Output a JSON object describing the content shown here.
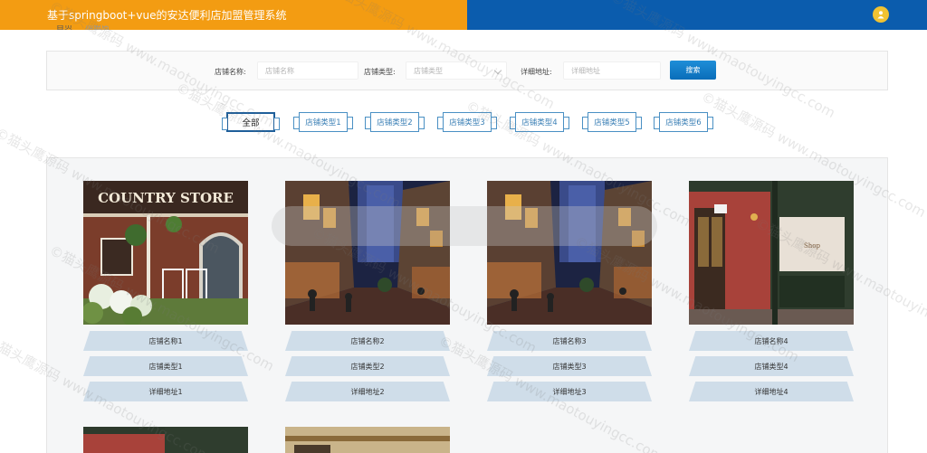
{
  "header": {
    "title": "基于springboot+vue的安达便利店加盟管理系统",
    "colors": {
      "left": "#f39c12",
      "right": "#0b5cad",
      "avatar": "#f1c232"
    }
  },
  "breadcrumb": [
    "首页",
    "加盟店"
  ],
  "search": {
    "name_label": "店铺名称:",
    "name_placeholder": "店铺名称",
    "type_label": "店铺类型:",
    "type_placeholder": "店铺类型",
    "address_label": "详细地址:",
    "address_placeholder": "详细地址",
    "button_label": "搜索"
  },
  "tabs": [
    {
      "label": "全部",
      "active": true
    },
    {
      "label": "店铺类型1",
      "active": false
    },
    {
      "label": "店铺类型2",
      "active": false
    },
    {
      "label": "店铺类型3",
      "active": false
    },
    {
      "label": "店铺类型4",
      "active": false
    },
    {
      "label": "店铺类型5",
      "active": false
    },
    {
      "label": "店铺类型6",
      "active": false
    }
  ],
  "cards": [
    {
      "image": "country-store-photo",
      "name": "店铺名称1",
      "type": "店铺类型1",
      "address": "详细地址1"
    },
    {
      "image": "street-night-photo",
      "name": "店铺名称2",
      "type": "店铺类型2",
      "address": "详细地址2"
    },
    {
      "image": "street-night-photo",
      "name": "店铺名称3",
      "type": "店铺类型3",
      "address": "详细地址3"
    },
    {
      "image": "brick-storefront-photo",
      "name": "店铺名称4",
      "type": "店铺类型4",
      "address": "详细地址4"
    }
  ],
  "watermark": "©猫头鹰源码 www.maotouyingcc.com"
}
